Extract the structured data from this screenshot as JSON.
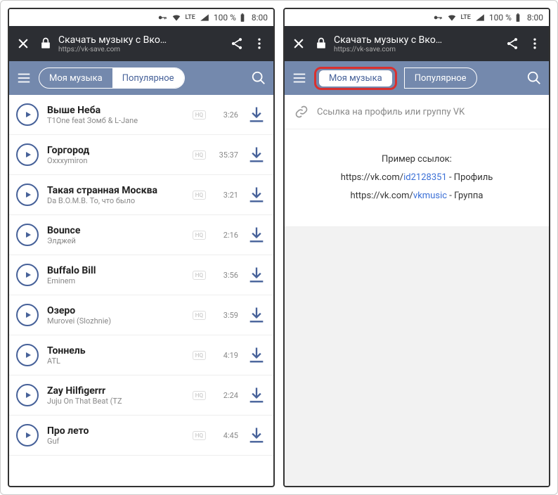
{
  "status": {
    "lte": "LTE",
    "battery": "100 %",
    "time": "8:00"
  },
  "appbar": {
    "title": "Скачать музыку с Вко…",
    "url": "https://vk-save.com"
  },
  "tabs": {
    "my": "Моя музыка",
    "popular": "Популярное"
  },
  "tracks": [
    {
      "name": "Выше Неба",
      "artist": "T1One feat Зомб & L-Jane",
      "duration": "3:26"
    },
    {
      "name": "Горгород",
      "artist": "Oxxxymiron",
      "duration": "35:37"
    },
    {
      "name": "Такая странная Москва",
      "artist": "Da B.O.M.B. То, что было",
      "duration": "3:21"
    },
    {
      "name": "Bounce",
      "artist": "Элджей",
      "duration": "2:16"
    },
    {
      "name": "Buffalo Bill",
      "artist": "Eminem",
      "duration": "3:56"
    },
    {
      "name": "Озеро",
      "artist": "Murovei (Slozhnie)",
      "duration": "3:59"
    },
    {
      "name": "Тоннель",
      "artist": "ATL",
      "duration": "4:19"
    },
    {
      "name": "Zay Hilfigerrr",
      "artist": "Juju On That Beat (TZ",
      "duration": "2:24"
    },
    {
      "name": "Про лето",
      "artist": "Guf",
      "duration": "4:45"
    }
  ],
  "hq": "HQ",
  "right": {
    "placeholder": "Ссылка на профиль или группу VK",
    "exTitle": "Пример ссылок:",
    "ex1pre": "https://vk.com/",
    "ex1link": "id2128351",
    "ex1suf": " - Профиль",
    "ex2pre": "https://vk.com/",
    "ex2link": "vkmusic",
    "ex2suf": " - Группа"
  }
}
